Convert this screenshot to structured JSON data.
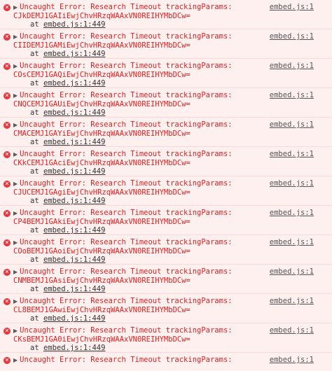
{
  "messages": [
    {
      "text": "Uncaught Error: Research Timeout trackingParams:",
      "param": "CJkDEMJ1GAIiEwjChvHRzqWAAxVN0REIHYMbDCw=",
      "at": "at",
      "location": "embed.js:1:449",
      "source": "embed.js:1"
    },
    {
      "text": "Uncaught Error: Research Timeout trackingParams:",
      "param": "CIIDEMJ1GAMiEwjChvHRzqWAAxVN0REIHYMbDCw=",
      "at": "at",
      "location": "embed.js:1:449",
      "source": "embed.js:1"
    },
    {
      "text": "Uncaught Error: Research Timeout trackingParams:",
      "param": "COsCEMJ1GAQiEwjChvHRzqWAAxVN0REIHYMbDCw=",
      "at": "at",
      "location": "embed.js:1:449",
      "source": "embed.js:1"
    },
    {
      "text": "Uncaught Error: Research Timeout trackingParams:",
      "param": "CNQCEMJ1GAUiEwjChvHRzqWAAxVN0REIHYMbDCw=",
      "at": "at",
      "location": "embed.js:1:449",
      "source": "embed.js:1"
    },
    {
      "text": "Uncaught Error: Research Timeout trackingParams:",
      "param": "CMACEMJ1GAYiEwjChvHRzqWAAxVN0REIHYMbDCw=",
      "at": "at",
      "location": "embed.js:1:449",
      "source": "embed.js:1"
    },
    {
      "text": "Uncaught Error: Research Timeout trackingParams:",
      "param": "CKkCEMJ1GAciEwjChvHRzqWAAxVN0REIHYMbDCw=",
      "at": "at",
      "location": "embed.js:1:449",
      "source": "embed.js:1"
    },
    {
      "text": "Uncaught Error: Research Timeout trackingParams:",
      "param": "CJUCEMJ1GAgiEwjChvHRzqWAAxVN0REIHYMbDCw=",
      "at": "at",
      "location": "embed.js:1:449",
      "source": "embed.js:1"
    },
    {
      "text": "Uncaught Error: Research Timeout trackingParams:",
      "param": "CP4BEMJ1GAkiEwjChvHRzqWAAxVN0REIHYMbDCw=",
      "at": "at",
      "location": "embed.js:1:449",
      "source": "embed.js:1"
    },
    {
      "text": "Uncaught Error: Research Timeout trackingParams:",
      "param": "COoBEMJ1GAoiEwjChvHRzqWAAxVN0REIHYMbDCw=",
      "at": "at",
      "location": "embed.js:1:449",
      "source": "embed.js:1"
    },
    {
      "text": "Uncaught Error: Research Timeout trackingParams:",
      "param": "CNMBEMJ1GAsiEwjChvHRzqWAAxVN0REIHYMbDCw=",
      "at": "at",
      "location": "embed.js:1:449",
      "source": "embed.js:1"
    },
    {
      "text": "Uncaught Error: Research Timeout trackingParams:",
      "param": "CL8BEMJ1GAwiEwjChvHRzqWAAxVN0REIHYMbDCw=",
      "at": "at",
      "location": "embed.js:1:449",
      "source": "embed.js:1"
    },
    {
      "text": "Uncaught Error: Research Timeout trackingParams:",
      "param": "CKsBEMJ1GA0iEwjChvHRzqWAAxVN0REIHYMbDCw=",
      "at": "at",
      "location": "embed.js:1:449",
      "source": "embed.js:1"
    },
    {
      "text": "Uncaught Error: Research Timeout trackingParams:",
      "param": "",
      "at": "",
      "location": "",
      "source": "embed.js:1"
    }
  ],
  "icons": {
    "error": "error-icon",
    "expand": "expand-triangle-icon"
  },
  "colors": {
    "error_text": "#e11f1f",
    "error_background": "#fff0f0",
    "error_border": "#ffd6d6",
    "error_icon": "#e8343a",
    "link": "#555555"
  }
}
